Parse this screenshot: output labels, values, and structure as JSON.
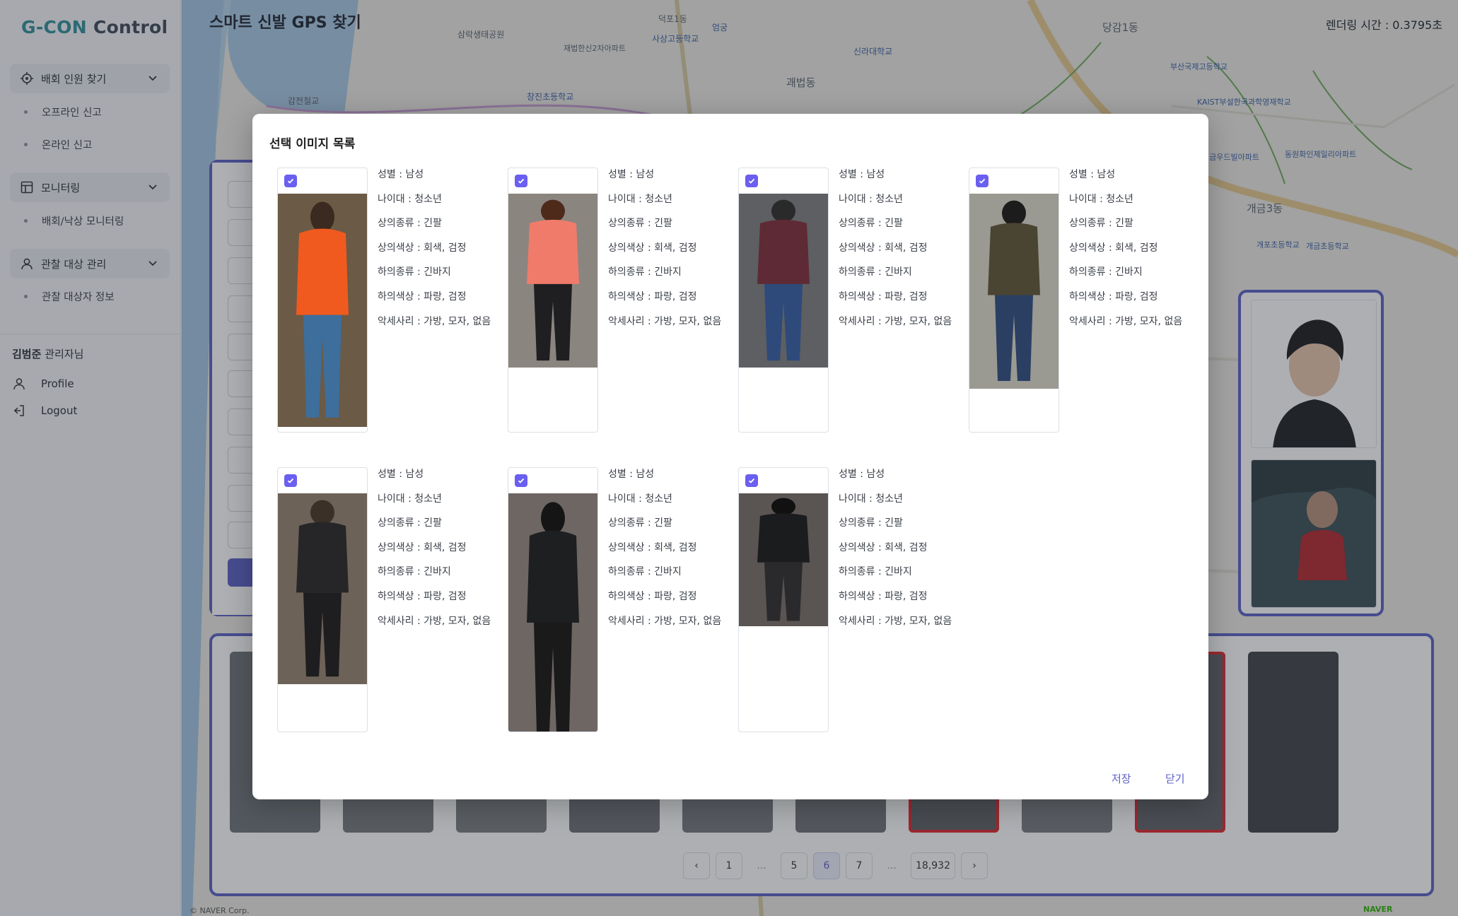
{
  "app": {
    "logo_mark": "G-CON",
    "logo_text": "Control"
  },
  "sidebar": {
    "groups": [
      {
        "label": "배회 인원 찾기",
        "icon": "target-icon",
        "items": [
          "오프라인 신고",
          "온라인 신고"
        ]
      },
      {
        "label": "모니터링",
        "icon": "layout-icon",
        "items": [
          "배회/낙상 모니터링"
        ]
      },
      {
        "label": "관찰 대상 관리",
        "icon": "person-icon",
        "items": [
          "관찰 대상자 정보"
        ]
      }
    ],
    "user_name": "김범준",
    "user_role": "관리자님",
    "profile_label": "Profile",
    "logout_label": "Logout"
  },
  "header": {
    "title": "스마트 신발 GPS 찾기",
    "render_time": "렌더링 시간 : 0.3795초"
  },
  "map": {
    "labels": [
      "삼락생태공원",
      "덕포1동",
      "사상고등학교",
      "엄궁",
      "재법한신2차아파트",
      "신라대학교",
      "괘법동",
      "당감1동",
      "부산국제고등학교",
      "KAIST부설한국과학영재학교",
      "개금3동",
      "개포초등학교",
      "개금초등학교",
      "창진초등학교",
      "감전철교",
      "개금우드빌아파트",
      "동원화인제일리아파트"
    ],
    "attribution": "© NAVER Corp.",
    "naver_logo": "NAVER"
  },
  "pagination": {
    "prev": "‹",
    "pages": [
      "1",
      "...",
      "5",
      "6",
      "7",
      "...",
      "18,932"
    ],
    "active": "6",
    "next": "›"
  },
  "modal": {
    "title": "선택 이미지 목록",
    "save_label": "저장",
    "close_label": "닫기",
    "cards": [
      {
        "gender": "성별 : 남성",
        "age": "나이대 : 청소년",
        "top_type": "상의종류 : 긴팔",
        "top_color": "상의색상 : 회색, 검정",
        "bottom_type": "하의종류 : 긴바지",
        "bottom_color": "하의색상 : 파랑, 검정",
        "accessory": "악세사리 : 가방, 모자, 없음",
        "photo_palette": "orange"
      },
      {
        "gender": "성별 : 남성",
        "age": "나이대 : 청소년",
        "top_type": "상의종류 : 긴팔",
        "top_color": "상의색상 : 회색, 검정",
        "bottom_type": "하의종류 : 긴바지",
        "bottom_color": "하의색상 : 파랑, 검정",
        "accessory": "악세사리 : 가방, 모자, 없음",
        "photo_palette": "pink"
      },
      {
        "gender": "성별 : 남성",
        "age": "나이대 : 청소년",
        "top_type": "상의종류 : 긴팔",
        "top_color": "상의색상 : 회색, 검정",
        "bottom_type": "하의종류 : 긴바지",
        "bottom_color": "하의색상 : 파랑, 검정",
        "accessory": "악세사리 : 가방, 모자, 없음",
        "photo_palette": "maroon"
      },
      {
        "gender": "성별 : 남성",
        "age": "나이대 : 청소년",
        "top_type": "상의종류 : 긴팔",
        "top_color": "상의색상 : 회색, 검정",
        "bottom_type": "하의종류 : 긴바지",
        "bottom_color": "하의색상 : 파랑, 검정",
        "accessory": "악세사리 : 가방, 모자, 없음",
        "photo_palette": "olive"
      },
      {
        "gender": "성별 : 남성",
        "age": "나이대 : 청소년",
        "top_type": "상의종류 : 긴팔",
        "top_color": "상의색상 : 회색, 검정",
        "bottom_type": "하의종류 : 긴바지",
        "bottom_color": "하의색상 : 파랑, 검정",
        "accessory": "악세사리 : 가방, 모자, 없음",
        "photo_palette": "dark-backpack"
      },
      {
        "gender": "성별 : 남성",
        "age": "나이대 : 청소년",
        "top_type": "상의종류 : 긴팔",
        "top_color": "상의색상 : 회색, 검정",
        "bottom_type": "하의종류 : 긴바지",
        "bottom_color": "하의색상 : 파랑, 검정",
        "accessory": "악세사리 : 가방, 모자, 없음",
        "photo_palette": "black-jacket"
      },
      {
        "gender": "성별 : 남성",
        "age": "나이대 : 청소년",
        "top_type": "상의종류 : 긴팔",
        "top_color": "상의색상 : 회색, 검정",
        "bottom_type": "하의종류 : 긴바지",
        "bottom_color": "하의색상 : 파랑, 검정",
        "accessory": "악세사리 : 가방, 모자, 없음",
        "photo_palette": "black-top"
      }
    ]
  },
  "colors": {
    "accent": "#5b5fc7",
    "checkbox": "#6a5ff0",
    "alert": "#e0262e"
  }
}
